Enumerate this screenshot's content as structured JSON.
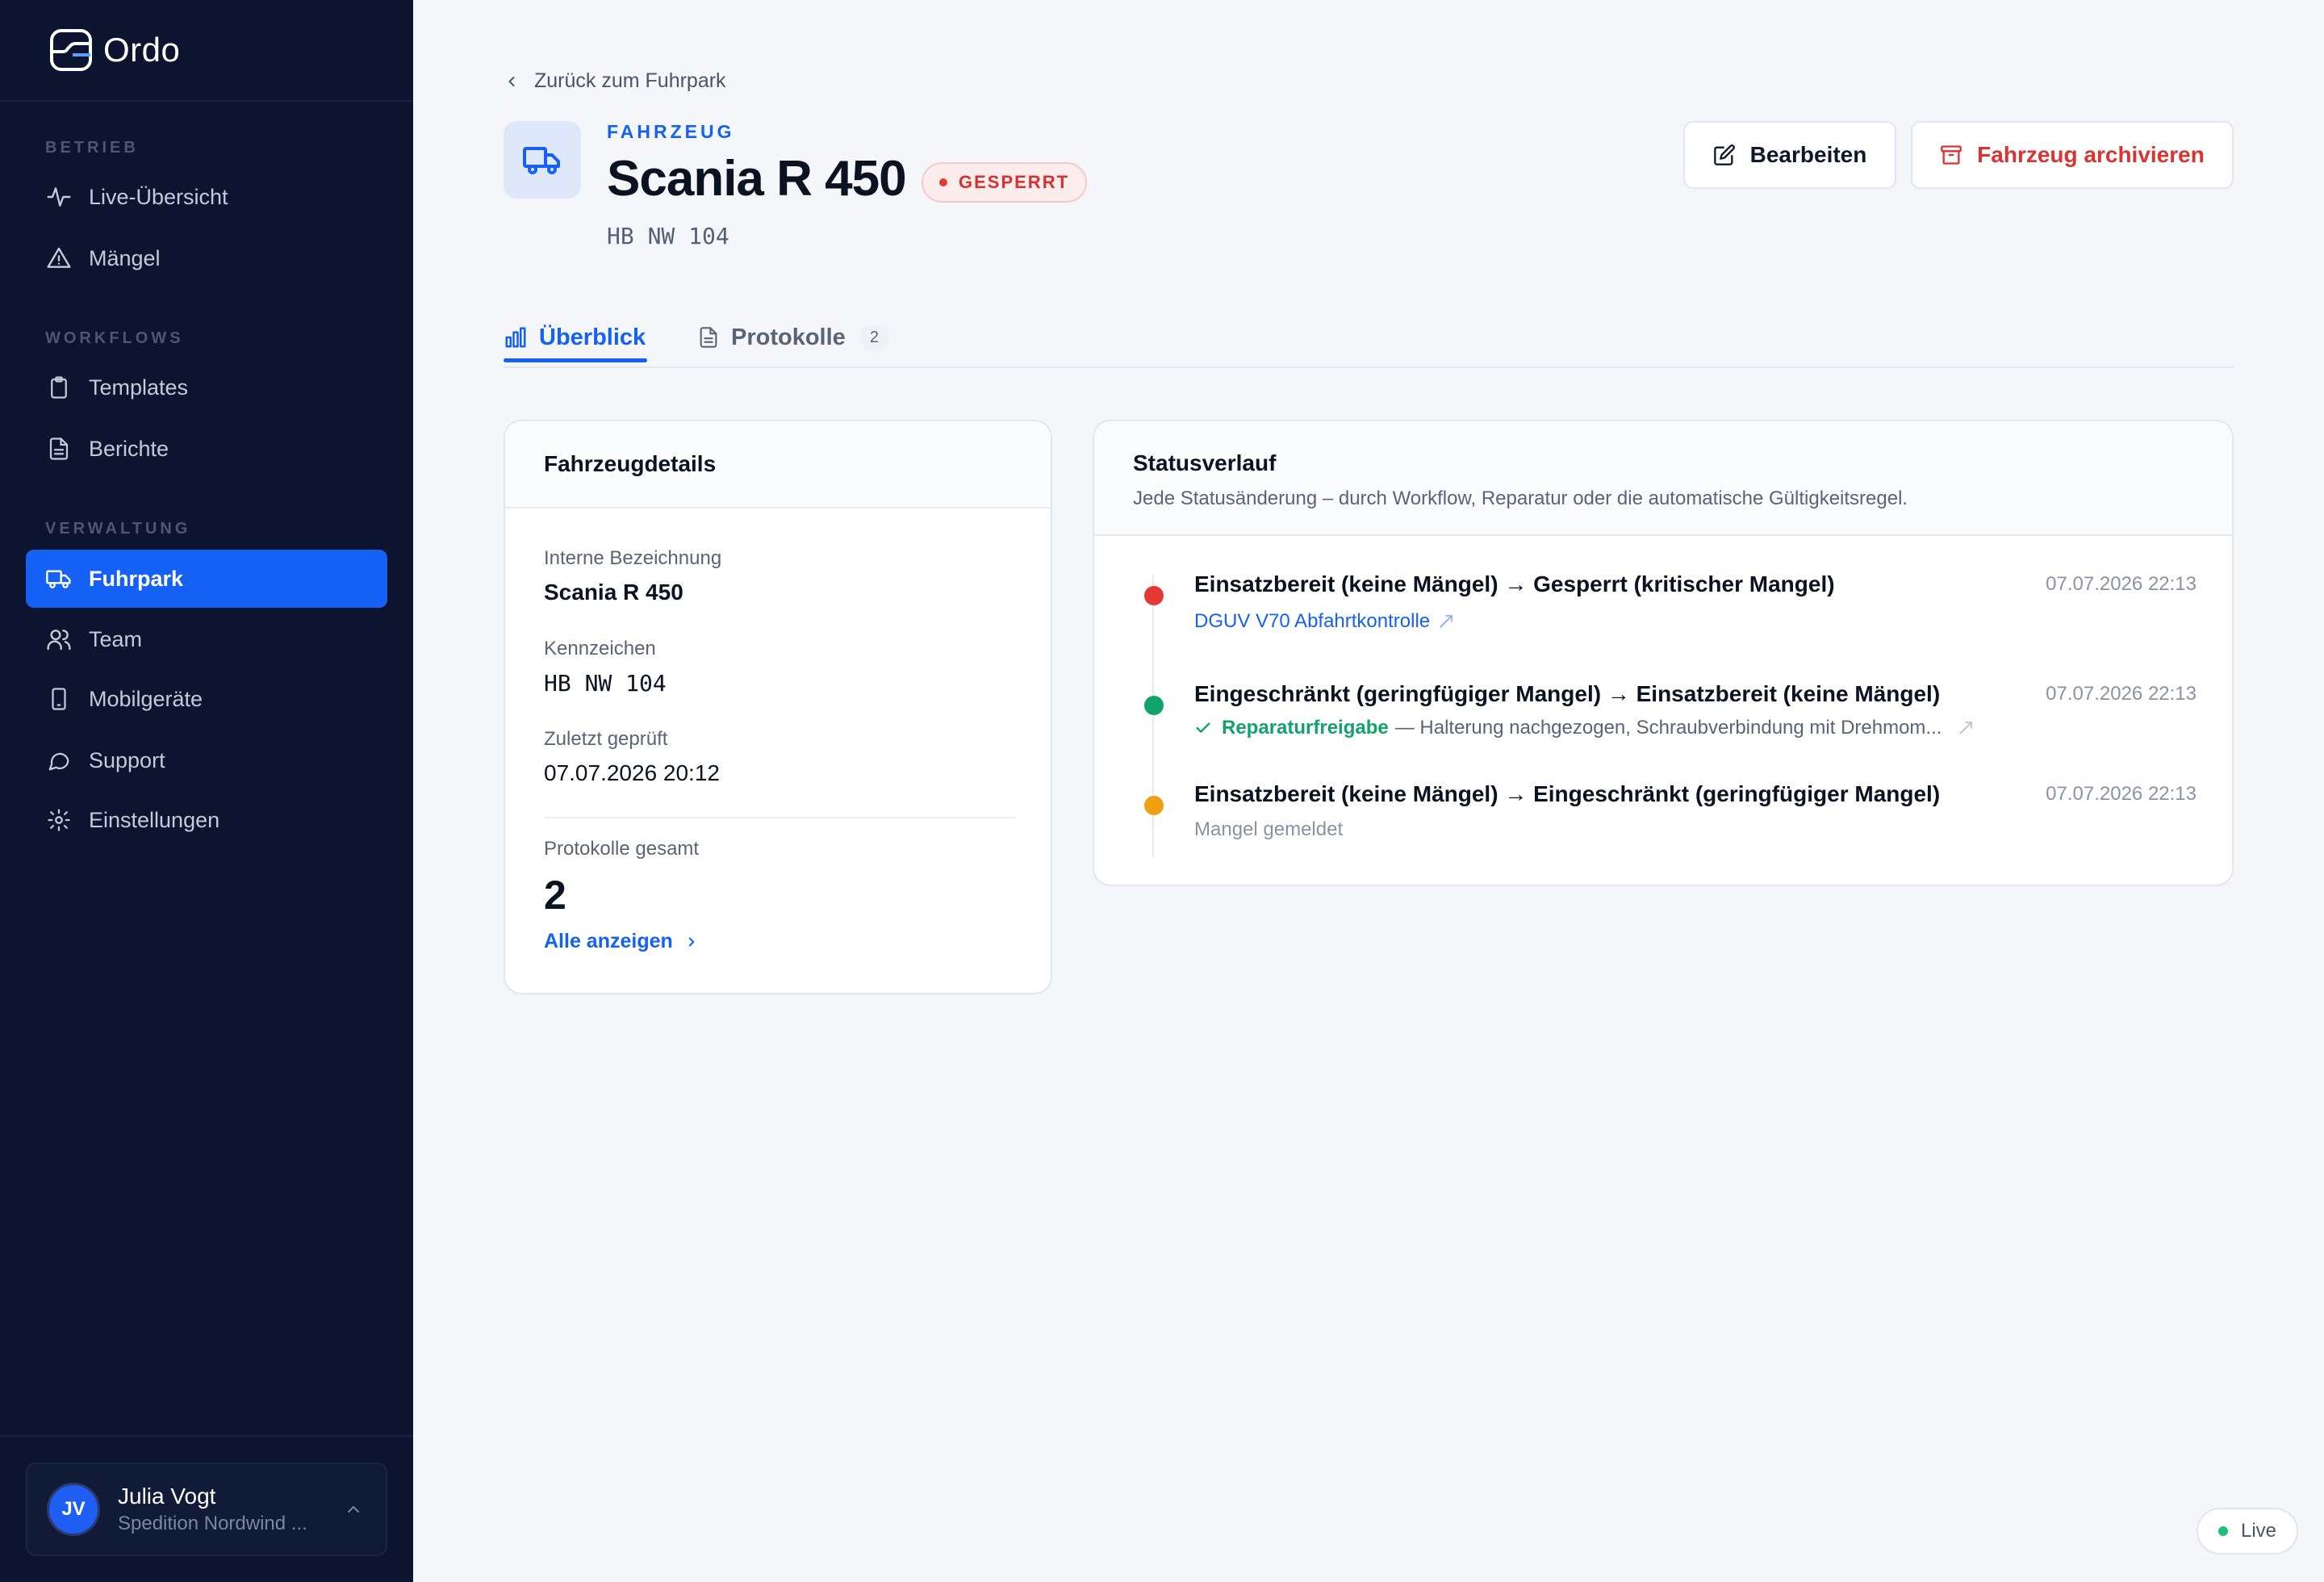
{
  "app": {
    "name": "Ordo"
  },
  "sidebar": {
    "sections": [
      {
        "label": "BETRIEB",
        "items": [
          {
            "label": "Live-Übersicht",
            "icon": "activity-icon"
          },
          {
            "label": "Mängel",
            "icon": "warning-icon"
          }
        ]
      },
      {
        "label": "WORKFLOWS",
        "items": [
          {
            "label": "Templates",
            "icon": "clipboard-icon"
          },
          {
            "label": "Berichte",
            "icon": "file-icon"
          }
        ]
      },
      {
        "label": "VERWALTUNG",
        "items": [
          {
            "label": "Fuhrpark",
            "icon": "truck-icon",
            "active": true
          },
          {
            "label": "Team",
            "icon": "users-icon"
          },
          {
            "label": "Mobilgeräte",
            "icon": "smartphone-icon"
          },
          {
            "label": "Support",
            "icon": "chat-icon"
          },
          {
            "label": "Einstellungen",
            "icon": "gear-icon"
          }
        ]
      }
    ],
    "user": {
      "initials": "JV",
      "name": "Julia Vogt",
      "org": "Spedition Nordwind ..."
    }
  },
  "header": {
    "back_label": "Zurück zum Fuhrpark",
    "eyebrow": "FAHRZEUG",
    "title": "Scania R 450",
    "status": "GESPERRT",
    "plate": "HB NW 104",
    "edit_label": "Bearbeiten",
    "archive_label": "Fahrzeug archivieren"
  },
  "tabs": [
    {
      "label": "Überblick",
      "active": true
    },
    {
      "label": "Protokolle",
      "count": "2"
    }
  ],
  "details": {
    "title": "Fahrzeugdetails",
    "internal_label": "Interne Bezeichnung",
    "internal_value": "Scania R 450",
    "plate_label": "Kennzeichen",
    "plate_value": "HB NW 104",
    "checked_label": "Zuletzt geprüft",
    "checked_value": "07.07.2026 20:12",
    "protocols_label": "Protokolle gesamt",
    "protocols_value": "2",
    "show_all": "Alle anzeigen"
  },
  "status_history": {
    "title": "Statusverlauf",
    "subtitle": "Jede Statusänderung – durch Workflow, Reparatur oder die automatische Gültigkeitsregel.",
    "entries": [
      {
        "title": "Einsatzbereit (keine Mängel) → Gesperrt (kritischer Mangel)",
        "time": "07.07.2026 22:13",
        "link": "DGUV V70 Abfahrtkontrolle",
        "color": "#e53935"
      },
      {
        "title": "Eingeschränkt (geringfügiger Mangel) → Einsatzbereit (keine Mängel)",
        "time": "07.07.2026 22:13",
        "release_label": "Reparaturfreigabe",
        "release_note": "— Halterung nachgezogen, Schraubverbindung mit Drehmom...",
        "color": "#12a36a"
      },
      {
        "title": "Einsatzbereit (keine Mängel) → Eingeschränkt (geringfügiger Mangel)",
        "time": "07.07.2026 22:13",
        "note": "Mangel gemeldet",
        "color": "#f0a010"
      }
    ]
  },
  "live_label": "Live",
  "colors": {
    "accent": "#1561f5",
    "sidebar_bg": "#0c1430",
    "danger": "#dc3232",
    "success": "#12a36a",
    "warning": "#f0a010"
  }
}
